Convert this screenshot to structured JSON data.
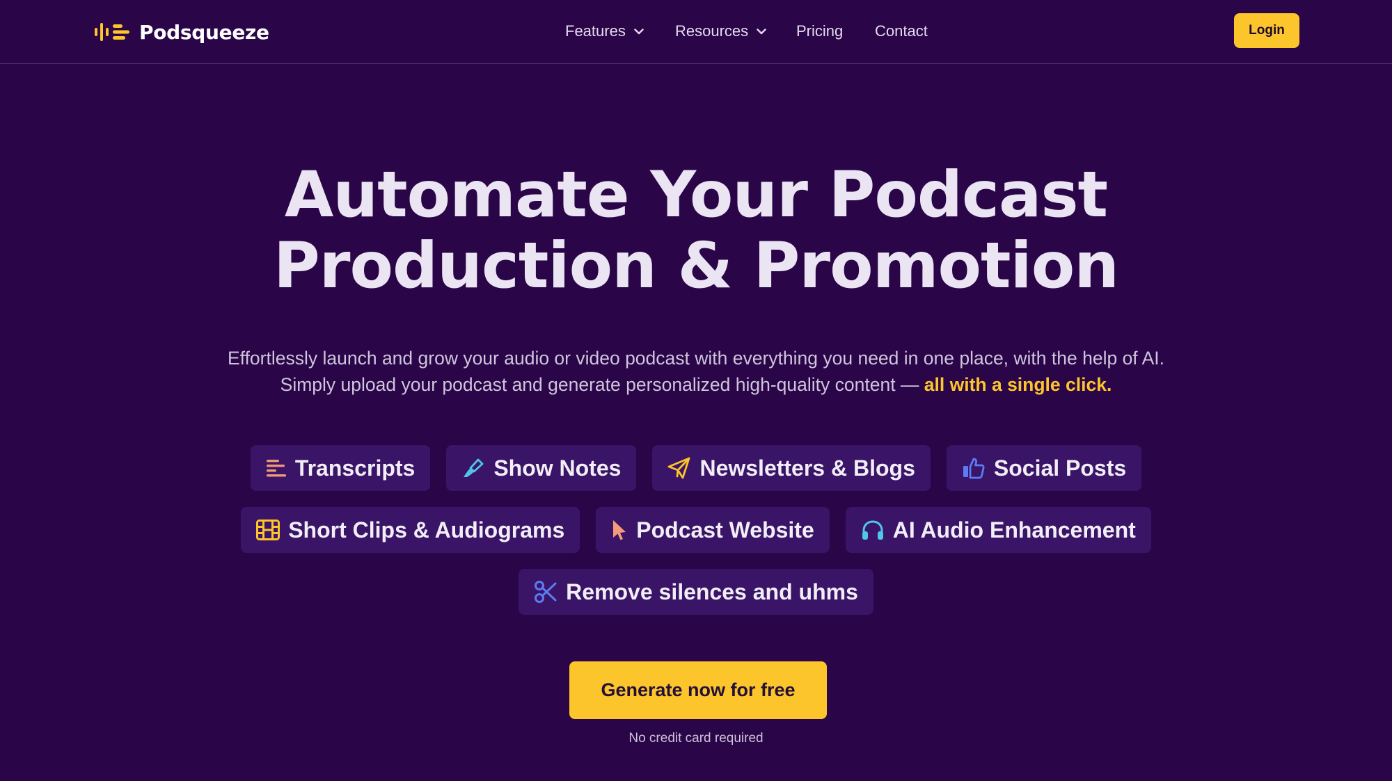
{
  "brand": {
    "name": "Podsqueeze",
    "accent": "#fcc52b",
    "background": "#2a0548"
  },
  "nav": {
    "items": [
      {
        "label": "Features",
        "has_dropdown": true
      },
      {
        "label": "Resources",
        "has_dropdown": true
      },
      {
        "label": "Pricing",
        "has_dropdown": false
      },
      {
        "label": "Contact",
        "has_dropdown": false
      }
    ],
    "login_label": "Login"
  },
  "hero": {
    "title_line1": "Automate Your Podcast",
    "title_line2": "Production & Promotion",
    "subtitle_line1": "Effortlessly launch and grow your audio or video podcast with everything you need in one place, with the help of AI.",
    "subtitle_line2": "Simply upload your podcast and generate personalized high-quality content — ",
    "subtitle_highlight": "all with a single click."
  },
  "features": [
    {
      "label": "Transcripts",
      "icon": "lines-icon",
      "color": "#f29a7a"
    },
    {
      "label": "Show Notes",
      "icon": "highlighter-icon",
      "color": "#4fc6ea"
    },
    {
      "label": "Newsletters & Blogs",
      "icon": "paper-plane-icon",
      "color": "#fcc52b"
    },
    {
      "label": "Social Posts",
      "icon": "thumbs-up-icon",
      "color": "#5b7cf4"
    },
    {
      "label": "Short Clips & Audiograms",
      "icon": "film-icon",
      "color": "#fcc52b"
    },
    {
      "label": "Podcast Website",
      "icon": "pointer-icon",
      "color": "#f29a7a"
    },
    {
      "label": "AI Audio Enhancement",
      "icon": "headphones-icon",
      "color": "#4fc6ea"
    },
    {
      "label": "Remove silences and uhms",
      "icon": "scissors-icon",
      "color": "#5b7cf4"
    }
  ],
  "cta": {
    "label": "Generate now for free",
    "note": "No credit card required"
  }
}
